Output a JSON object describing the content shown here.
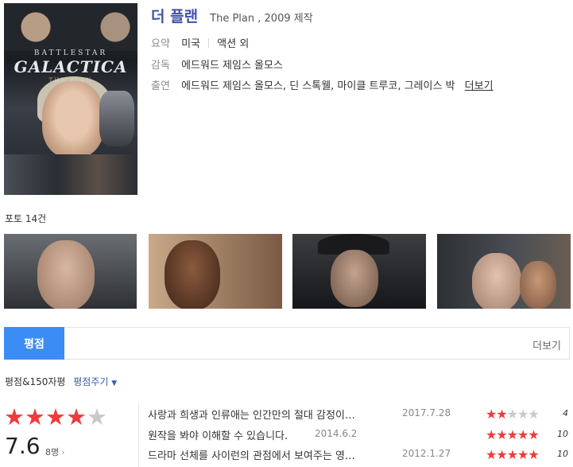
{
  "movie": {
    "title_ko": "더 플랜",
    "title_en": "The Plan , 2009 제작",
    "poster_text": {
      "top": "BATTLESTAR",
      "main": "GALACTICA",
      "sub": "THE PLAN"
    },
    "summary_label": "요약",
    "summary_country": "미국",
    "summary_genre": "액션 외",
    "director_label": "감독",
    "director": "에드워드 제임스 올모스",
    "cast_label": "출연",
    "cast": "에드워드 제임스 올모스, 딘 스톡웰, 마이클 트루코, 그레이스 박",
    "cast_more": "더보기"
  },
  "photos": {
    "label": "포토 14건"
  },
  "tabs": {
    "active": "평점",
    "more": "더보기"
  },
  "rating": {
    "header": "평점&150자평",
    "give_label": "평점주기",
    "caret": "▼",
    "average": "7.6",
    "count": "8명",
    "count_arrow": "›",
    "stars_filled": 4,
    "stars_total": 5
  },
  "reviews": [
    {
      "text": "사랑과 희생과 인류애는 인간만의 절대 감정이…",
      "date": "2017.7.28",
      "score": "4",
      "stars": 2
    },
    {
      "text": "원작을 봐야 이해할 수 있습니다.",
      "date": "2014.6.2",
      "score": "10",
      "stars": 5
    },
    {
      "text": "드라마 선체를 사이런의 관점에서 보여주는 영…",
      "date": "2012.1.27",
      "score": "10",
      "stars": 5
    }
  ],
  "colors": {
    "accent": "#3b8df5",
    "title": "#4352a8",
    "star": "#ef3b3b",
    "star_off": "#c9c9c9"
  }
}
